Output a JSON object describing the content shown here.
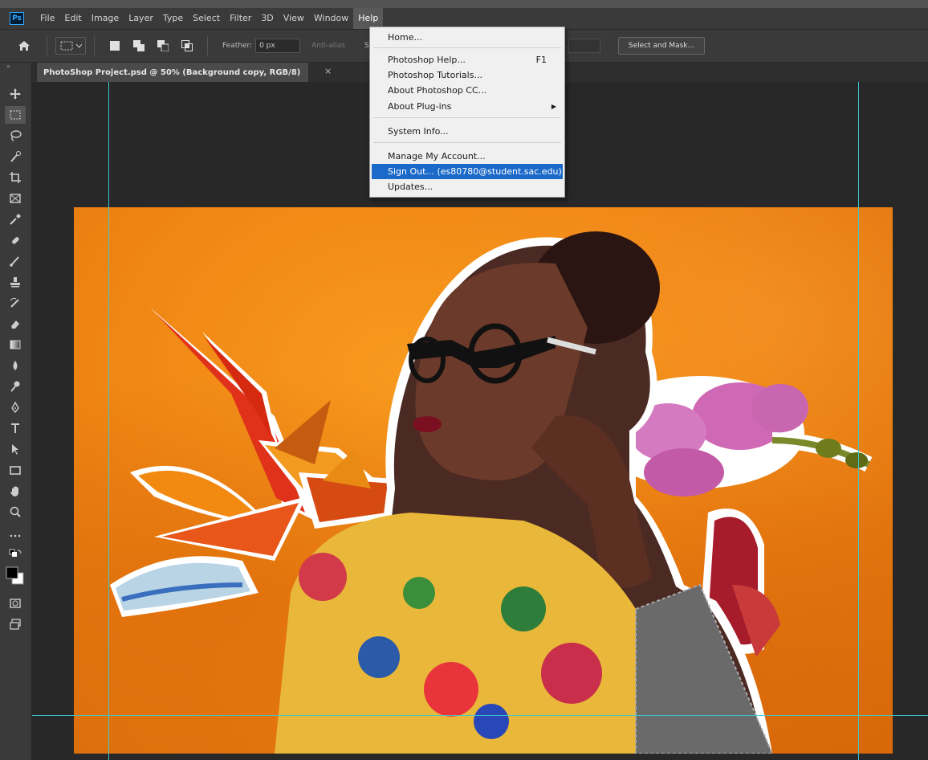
{
  "menubar": {
    "logo": "Ps",
    "items": [
      "File",
      "Edit",
      "Image",
      "Layer",
      "Type",
      "Select",
      "Filter",
      "3D",
      "View",
      "Window",
      "Help"
    ],
    "active": "Help"
  },
  "options": {
    "feather_label": "Feather:",
    "feather_value": "0 px",
    "antialias_label": "Anti-alias",
    "style_label": "Style:",
    "select_mask_label": "Select and Mask..."
  },
  "document": {
    "tab_title": "PhotoShop Project.psd @ 50% (Background copy, RGB/8)",
    "close_glyph": "×"
  },
  "help_menu": {
    "items": [
      {
        "label": "Home..."
      },
      {
        "label": "Photoshop Help...",
        "shortcut": "F1"
      },
      {
        "label": "Photoshop Tutorials..."
      },
      {
        "label": "About Photoshop CC..."
      },
      {
        "label": "About Plug-ins",
        "submenu": true
      },
      {
        "label": "System Info..."
      },
      {
        "label": "Manage My Account..."
      },
      {
        "label": "Sign Out... (es80780@student.sac.edu)",
        "highlighted": true
      },
      {
        "label": "Updates..."
      }
    ]
  },
  "tools": [
    "move-tool",
    "rectangular-marquee-tool",
    "lasso-tool",
    "quick-selection-tool",
    "crop-tool",
    "frame-tool",
    "eyedropper-tool",
    "spot-healing-tool",
    "brush-tool",
    "clone-stamp-tool",
    "history-brush-tool",
    "eraser-tool",
    "gradient-tool",
    "blur-tool",
    "dodge-tool",
    "pen-tool",
    "type-tool",
    "path-selection-tool",
    "rectangle-tool",
    "hand-tool",
    "zoom-tool",
    "edit-toolbar",
    "default-colors",
    "foreground-background-colors",
    "quick-mask-mode",
    "screen-mode"
  ],
  "colors": {
    "accent_highlight": "#1b6ac9",
    "guide": "#3ec7d1",
    "canvas_orange": "#ef8413"
  }
}
